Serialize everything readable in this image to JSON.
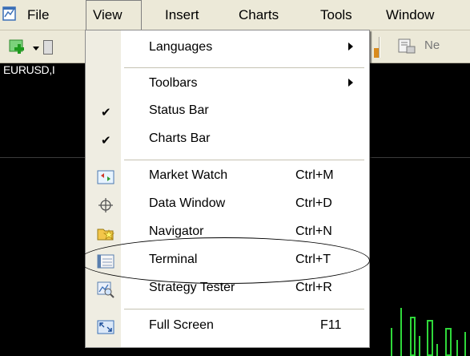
{
  "menubar": {
    "items": [
      {
        "label": "File"
      },
      {
        "label": "View"
      },
      {
        "label": "Insert"
      },
      {
        "label": "Charts"
      },
      {
        "label": "Tools"
      },
      {
        "label": "Window"
      }
    ]
  },
  "toolbar": {
    "partial_label": "Ne"
  },
  "chart": {
    "title": "EURUSD,I",
    "candle_color": "#2fd83a"
  },
  "view_menu": {
    "items": [
      {
        "label": "Languages",
        "submenu": true
      },
      {
        "label": "Toolbars",
        "submenu": true
      },
      {
        "label": "Status Bar",
        "checked": true
      },
      {
        "label": "Charts Bar",
        "checked": true
      },
      {
        "label": "Market Watch",
        "shortcut": "Ctrl+M",
        "icon": "market-watch-icon"
      },
      {
        "label": "Data Window",
        "shortcut": "Ctrl+D",
        "icon": "crosshair-icon"
      },
      {
        "label": "Navigator",
        "shortcut": "Ctrl+N",
        "icon": "navigator-icon"
      },
      {
        "label": "Terminal",
        "shortcut": "Ctrl+T",
        "icon": "terminal-icon"
      },
      {
        "label": "Strategy Tester",
        "shortcut": "Ctrl+R",
        "icon": "strategy-tester-icon"
      },
      {
        "label": "Full Screen",
        "shortcut": "F11",
        "icon": "full-screen-icon"
      }
    ]
  },
  "colors": {
    "menu_bg": "#ece9d8",
    "chart_bg": "#000000",
    "annotation": "#000000"
  }
}
